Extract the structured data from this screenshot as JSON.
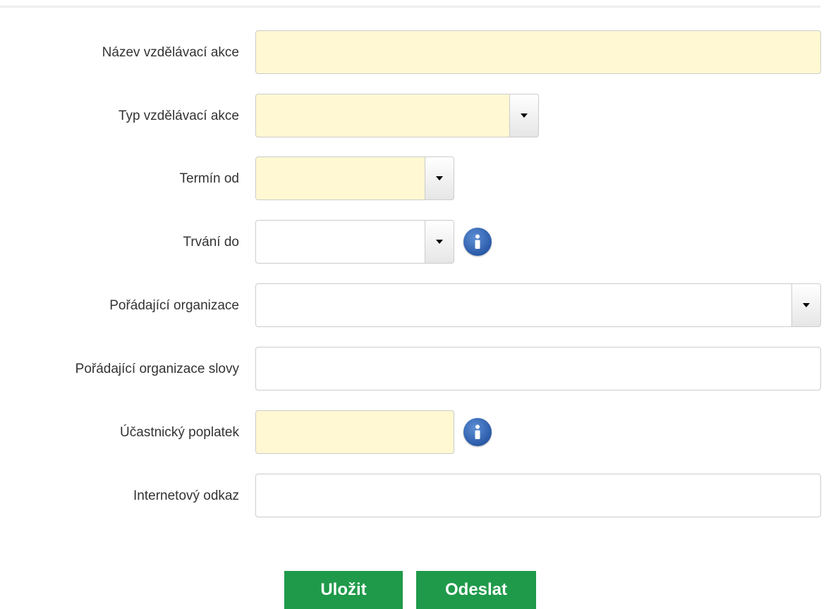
{
  "form": {
    "fields": [
      {
        "label": "Název vzdělávací akce",
        "value": "",
        "required": true
      },
      {
        "label": "Typ vzdělávací akce",
        "value": "",
        "required": true
      },
      {
        "label": "Termín od",
        "value": "",
        "required": true
      },
      {
        "label": "Trvání do",
        "value": "",
        "required": false
      },
      {
        "label": "Pořádající organizace",
        "value": "",
        "required": false
      },
      {
        "label": "Pořádající organizace slovy",
        "value": "",
        "required": false
      },
      {
        "label": "Účastnický poplatek",
        "value": "",
        "required": true
      },
      {
        "label": "Internetový odkaz",
        "value": "",
        "required": false
      }
    ]
  },
  "buttons": {
    "save_label": "Uložit",
    "send_label": "Odeslat"
  },
  "colors": {
    "required_bg": "#fff8d2",
    "button_green": "#1f9a4a",
    "info_blue": "#2a5aa8"
  },
  "icons": {
    "dropdown": "caret-down-icon",
    "info": "info-icon"
  }
}
